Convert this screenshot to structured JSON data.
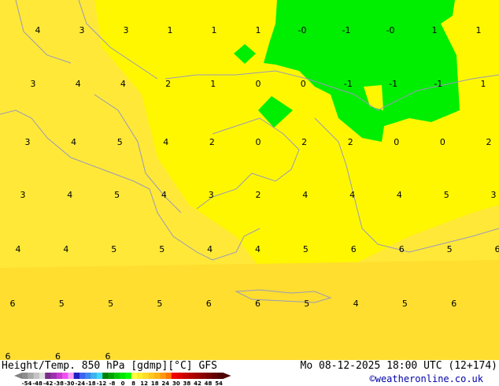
{
  "map": {
    "field_colors": {
      "warm_yellow": "#ffe838",
      "bright_yellow": "#fff700",
      "green": "#00ee00",
      "coast": "#9a9ab8"
    },
    "labels": [
      [
        "4",
        "3",
        "3",
        "1",
        "1",
        "1",
        "-0",
        "-1",
        "-0",
        "1",
        "1"
      ],
      [
        "3",
        "4",
        "4",
        "2",
        "1",
        "0",
        "0",
        "-1",
        "-1",
        "-1",
        "1"
      ],
      [
        "3",
        "4",
        "5",
        "4",
        "2",
        "0",
        "2",
        "2",
        "0",
        "0",
        "2"
      ],
      [
        "3",
        "4",
        "5",
        "4",
        "3",
        "2",
        "4",
        "4",
        "4",
        "5",
        "3"
      ],
      [
        "4",
        "4",
        "5",
        "5",
        "4",
        "4",
        "5",
        "6",
        "6",
        "5",
        "6"
      ],
      [
        "6",
        "5",
        "5",
        "5",
        "6",
        "6",
        "5",
        "4",
        "5",
        "6"
      ],
      [
        "6",
        "6",
        "6"
      ]
    ]
  },
  "footer": {
    "title": "Height/Temp. 850 hPa [gdmp][°C] GFS",
    "datetime": "Mo 08-12-2025 18:00 UTC (12+174)",
    "credit": "©weatheronline.co.uk",
    "scale_ticks": [
      "-54",
      "-48",
      "-42",
      "-38",
      "-30",
      "-24",
      "-18",
      "-12",
      "-8",
      "0",
      "8",
      "12",
      "18",
      "24",
      "30",
      "38",
      "42",
      "48",
      "54"
    ],
    "scale_colors": [
      "#8c8c8c",
      "#a8a8a8",
      "#c4c4c4",
      "#e0e0e0",
      "#7a2e8a",
      "#a030b0",
      "#c83cd0",
      "#f050f0",
      "#f8a0f8",
      "#2020c0",
      "#3c64f0",
      "#3c8cf0",
      "#3cb4f0",
      "#3cdcf0",
      "#008000",
      "#00a000",
      "#00c800",
      "#00e600",
      "#00ff00",
      "#ffff40",
      "#ffee30",
      "#ffdc28",
      "#ffc820",
      "#ffb418",
      "#ff9c10",
      "#ff7800",
      "#f00000",
      "#dc0000",
      "#c80000",
      "#b40000",
      "#a00000",
      "#8c0000",
      "#780000",
      "#640000",
      "#500000"
    ]
  }
}
